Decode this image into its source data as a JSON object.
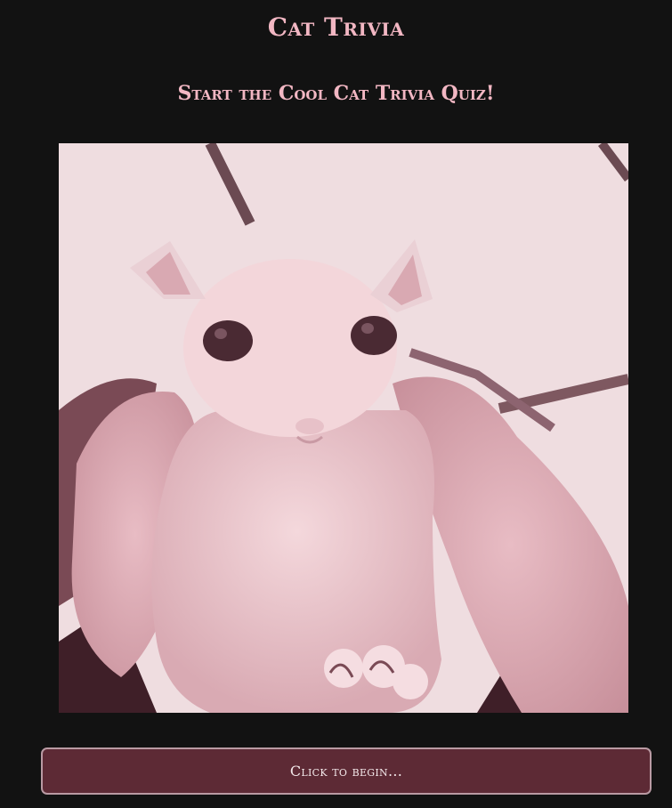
{
  "header": {
    "title": "Cat Trivia",
    "subtitle": "Start the Cool Cat Trivia Quiz!"
  },
  "main": {
    "image_subject": "hairless-cat-photo",
    "start_button_label": "Click to begin..."
  },
  "colors": {
    "background": "#121212",
    "title_pink": "#f2b7c3",
    "button_fill": "#5d2a35",
    "button_border": "#b99aa3",
    "button_text": "#f3e8ea"
  }
}
